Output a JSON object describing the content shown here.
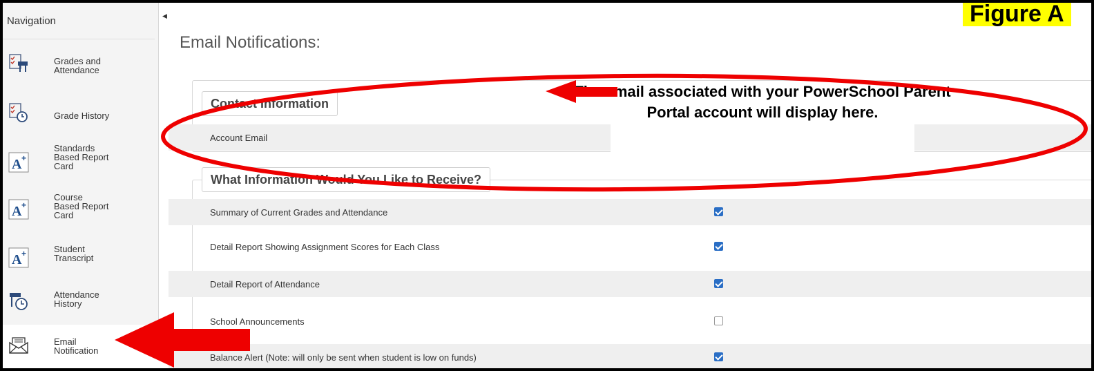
{
  "sidebar": {
    "title": "Navigation",
    "items": [
      {
        "label": "Grades and\nAttendance",
        "icon": "grades-attendance-icon"
      },
      {
        "label": "Grade History",
        "icon": "grade-history-icon"
      },
      {
        "label": "Standards\nBased Report\nCard",
        "icon": "report-card-icon"
      },
      {
        "label": "Course\nBased Report\nCard",
        "icon": "report-card-icon"
      },
      {
        "label": "Student\nTranscript",
        "icon": "report-card-icon"
      },
      {
        "label": "Attendance\nHistory",
        "icon": "attendance-history-icon"
      },
      {
        "label": "Email\nNotification",
        "icon": "email-icon"
      }
    ]
  },
  "main": {
    "title": "Email Notifications:",
    "contact": {
      "legend": "Contact Information",
      "account_email_label": "Account Email"
    },
    "receive": {
      "legend": "What Information Would You Like to Receive?",
      "options": [
        {
          "label": "Summary of Current Grades and Attendance",
          "checked": true
        },
        {
          "label": "Detail Report Showing Assignment Scores for Each Class",
          "checked": true
        },
        {
          "label": "Detail Report of Attendance",
          "checked": true
        },
        {
          "label": "School Announcements",
          "checked": false
        },
        {
          "label": "Balance Alert (Note: will only be sent when student is low on funds)",
          "checked": true
        }
      ]
    }
  },
  "overlay": {
    "figure_label": "Figure A",
    "annotation": "The email associated with your PowerSchool Parent Portal account will display here.",
    "colors": {
      "arrow": "#ee0000",
      "ellipse": "#ee0000",
      "highlight": "#ffff00",
      "checkbox": "#2a6ec5"
    }
  }
}
